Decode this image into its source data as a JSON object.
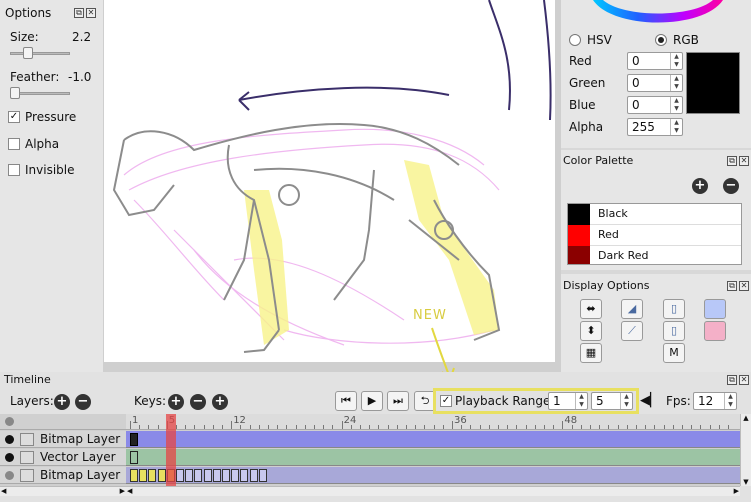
{
  "options": {
    "title": "Options",
    "size_label": "Size:",
    "size_value": "2.2",
    "size_level": 0.25,
    "feather_label": "Feather:",
    "feather_value": "-1.0",
    "feather_level": 0.0,
    "pressure_label": "Pressure",
    "pressure_checked": true,
    "alpha_label": "Alpha",
    "invisible_label": "Invisible"
  },
  "color": {
    "mode_hsv": "HSV",
    "mode_rgb": "RGB",
    "selected_mode": "RGB",
    "red_label": "Red",
    "red_value": "0",
    "green_label": "Green",
    "green_value": "0",
    "blue_label": "Blue",
    "blue_value": "0",
    "alpha_label": "Alpha",
    "alpha_value": "255",
    "swatch_color": "#000000"
  },
  "palette": {
    "title": "Color Palette",
    "items": [
      {
        "name": "Black",
        "color": "#000000"
      },
      {
        "name": "Red",
        "color": "#ff0000"
      },
      {
        "name": "Dark Red",
        "color": "#8b0000"
      }
    ]
  },
  "display": {
    "title": "Display Options",
    "m_label": "M"
  },
  "annotation": {
    "new_label": "NEW",
    "highlight_color": "#e8e060"
  },
  "timeline": {
    "title": "Timeline",
    "layers_label": "Layers:",
    "keys_label": "Keys:",
    "playback_range_label": "Playback Range",
    "playback_checked": true,
    "range_start": "1",
    "range_end": "5",
    "fps_label": "Fps:",
    "fps_value": "12",
    "ruler_ticks": [
      "1",
      "5",
      "12",
      "24",
      "36",
      "48"
    ],
    "current_frame": 5,
    "layers": [
      {
        "name": "Bitmap Layer",
        "color": "#8a8ae8"
      },
      {
        "name": "Vector Layer",
        "color": "#9cc4a4"
      },
      {
        "name": "Bitmap Layer",
        "color": "#a8a8d8"
      }
    ]
  }
}
